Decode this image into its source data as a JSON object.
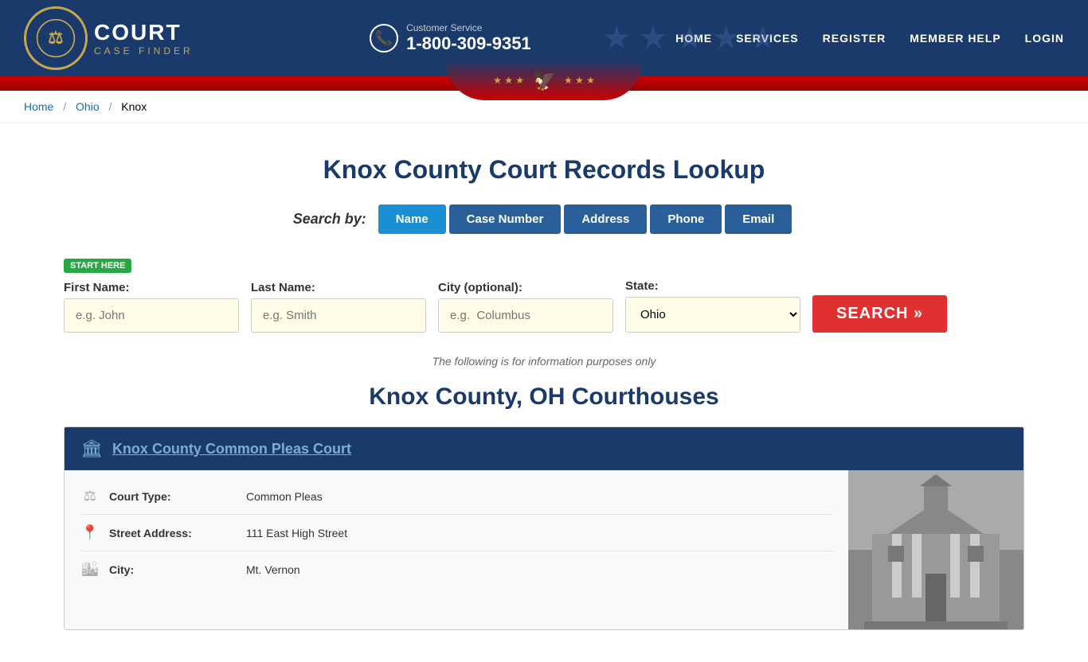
{
  "header": {
    "logo_court": "COURT",
    "logo_case_finder": "CASE FINDER",
    "customer_service_label": "Customer Service",
    "customer_service_phone": "1-800-309-9351",
    "nav": [
      "HOME",
      "SERVICES",
      "REGISTER",
      "MEMBER HELP",
      "LOGIN"
    ]
  },
  "breadcrumb": {
    "home": "Home",
    "state": "Ohio",
    "county": "Knox"
  },
  "search": {
    "title": "Knox County Court Records Lookup",
    "search_by_label": "Search by:",
    "tabs": [
      "Name",
      "Case Number",
      "Address",
      "Phone",
      "Email"
    ],
    "active_tab": "Name",
    "start_here": "START HERE",
    "fields": {
      "first_name_label": "First Name:",
      "first_name_placeholder": "e.g. John",
      "last_name_label": "Last Name:",
      "last_name_placeholder": "e.g. Smith",
      "city_label": "City (optional):",
      "city_placeholder": "e.g.  Columbus",
      "state_label": "State:",
      "state_value": "Ohio"
    },
    "search_button": "SEARCH »",
    "info_note": "The following is for information purposes only"
  },
  "courthouses": {
    "section_title": "Knox County, OH Courthouses",
    "items": [
      {
        "name": "Knox County Common Pleas Court",
        "url": "#",
        "details": [
          {
            "icon": "⚖",
            "label": "Court Type:",
            "value": "Common Pleas"
          },
          {
            "icon": "📍",
            "label": "Street Address:",
            "value": "111 East High Street"
          },
          {
            "icon": "🏙",
            "label": "City:",
            "value": "Mt. Vernon"
          }
        ]
      }
    ]
  }
}
